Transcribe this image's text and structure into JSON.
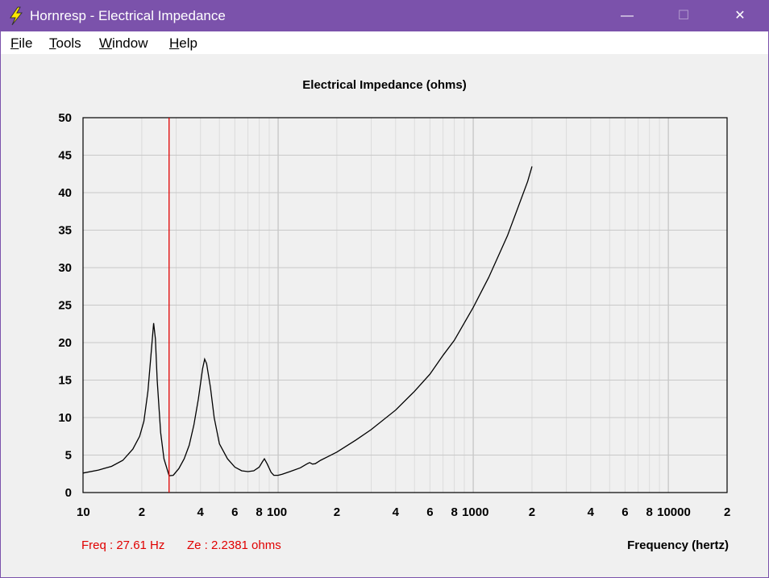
{
  "window": {
    "title": "Hornresp - Electrical Impedance",
    "min_glyph": "—",
    "max_glyph": "☐",
    "close_glyph": "✕"
  },
  "menu": [
    {
      "accel": "F",
      "rest": "ile"
    },
    {
      "accel": "T",
      "rest": "ools"
    },
    {
      "accel": "W",
      "rest": "indow"
    },
    {
      "accel": "H",
      "rest": "elp"
    }
  ],
  "readout": {
    "freq": "Freq : 27.61 Hz",
    "ze": "Ze : 2.2381 ohms"
  },
  "colors": {
    "curve": "#000000",
    "cursor": "#e00000",
    "grid_major": "#c8c8c8",
    "grid_minor": "#dcdcdc",
    "titlebar": "#7b52ab"
  },
  "chart_data": {
    "type": "line",
    "title": "Electrical Impedance (ohms)",
    "xlabel": "Frequency (hertz)",
    "ylabel": "",
    "x_scale": "log",
    "xlim": [
      10,
      20000
    ],
    "ylim": [
      0,
      50
    ],
    "yticks": [
      0,
      5,
      10,
      15,
      20,
      25,
      30,
      35,
      40,
      45,
      50
    ],
    "xtick_labels": [
      {
        "x": 10,
        "label": "10"
      },
      {
        "x": 20,
        "label": "2"
      },
      {
        "x": 40,
        "label": "4"
      },
      {
        "x": 60,
        "label": "6"
      },
      {
        "x": 80,
        "label": "8"
      },
      {
        "x": 100,
        "label": "100"
      },
      {
        "x": 200,
        "label": "2"
      },
      {
        "x": 400,
        "label": "4"
      },
      {
        "x": 600,
        "label": "6"
      },
      {
        "x": 800,
        "label": "8"
      },
      {
        "x": 1000,
        "label": "1000"
      },
      {
        "x": 2000,
        "label": "2"
      },
      {
        "x": 4000,
        "label": "4"
      },
      {
        "x": 6000,
        "label": "6"
      },
      {
        "x": 8000,
        "label": "8"
      },
      {
        "x": 10000,
        "label": "10000"
      },
      {
        "x": 20000,
        "label": "2"
      }
    ],
    "cursor_x": 27.61,
    "grid": true,
    "series": [
      {
        "x": [
          10,
          12,
          14,
          16,
          18,
          19.5,
          20.5,
          21.5,
          22.5,
          23,
          23.5,
          24,
          25,
          26,
          27.61,
          29,
          31,
          33,
          35,
          37,
          39,
          41,
          42,
          43,
          45,
          47,
          50,
          55,
          60,
          65,
          70,
          75,
          80,
          83,
          85,
          88,
          92,
          95,
          100,
          105,
          115,
          130,
          140,
          145,
          150,
          155,
          165,
          180,
          200,
          250,
          300,
          400,
          500,
          600,
          700,
          800,
          1000,
          1200,
          1500,
          1900,
          2000
        ],
        "y": [
          2.6,
          3.0,
          3.5,
          4.3,
          5.8,
          7.5,
          9.5,
          13.5,
          19.5,
          22.6,
          20.5,
          15.0,
          8.0,
          4.5,
          2.24,
          2.3,
          3.2,
          4.5,
          6.3,
          9.0,
          12.5,
          16.5,
          17.8,
          17.2,
          14.0,
          10.0,
          6.5,
          4.5,
          3.4,
          2.9,
          2.8,
          2.9,
          3.4,
          4.1,
          4.5,
          3.8,
          2.7,
          2.3,
          2.3,
          2.45,
          2.8,
          3.3,
          3.8,
          4.0,
          3.8,
          3.85,
          4.3,
          4.8,
          5.4,
          7.0,
          8.4,
          11.0,
          13.5,
          15.8,
          18.3,
          20.3,
          24.7,
          28.7,
          34.3,
          41.5,
          43.5
        ]
      }
    ]
  }
}
